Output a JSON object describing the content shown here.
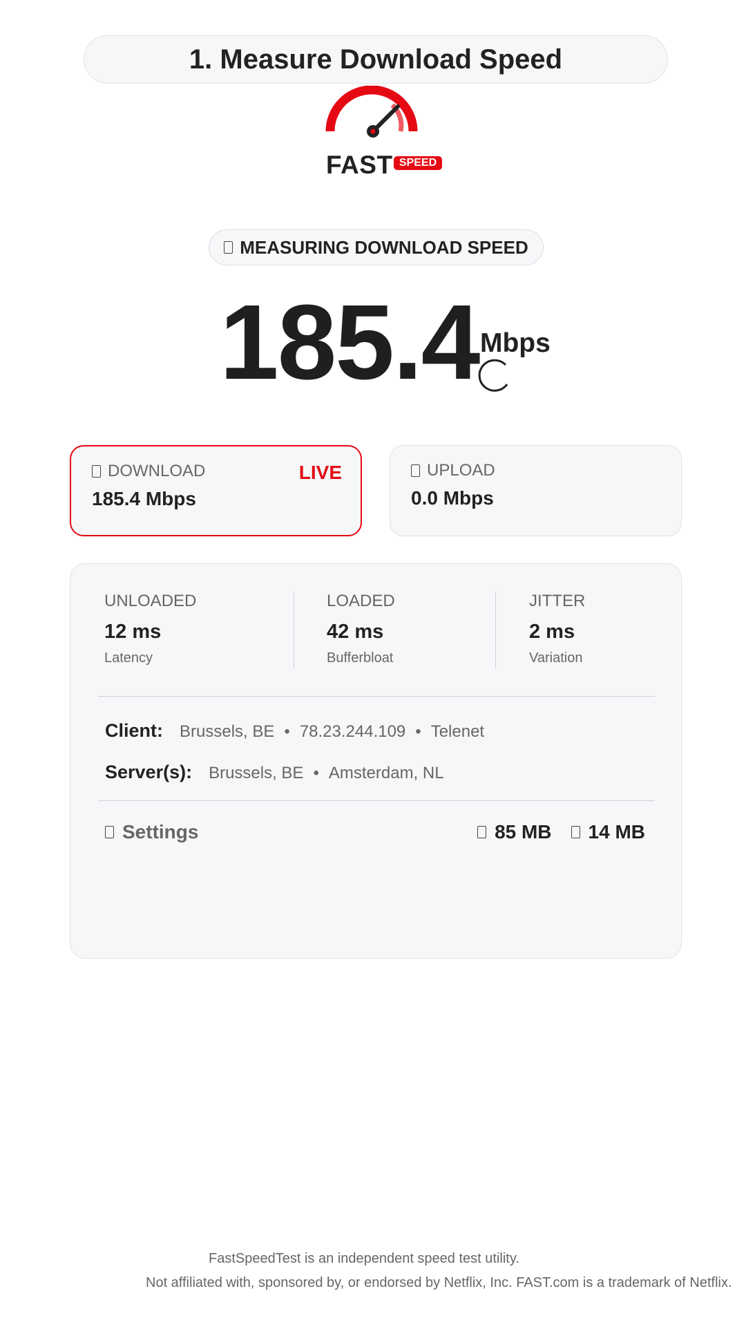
{
  "header": {
    "title": "1. Measure Download Speed"
  },
  "logo": {
    "word": "FAST",
    "badge": "SPEED",
    "brand_color": "#e50914",
    "icon": "speedometer-icon"
  },
  "status": {
    "icon": "gauge-icon",
    "text": "MEASURING DOWNLOAD SPEED"
  },
  "measurement": {
    "value": "185.4",
    "unit": "Mbps",
    "loading_icon": "spinner-icon"
  },
  "cards": {
    "download": {
      "icon": "download-icon",
      "label": "DOWNLOAD",
      "value": "185.4 Mbps",
      "badge": "LIVE"
    },
    "upload": {
      "icon": "upload-icon",
      "label": "UPLOAD",
      "value": "0.0 Mbps"
    }
  },
  "metrics": [
    {
      "label": "UNLOADED",
      "value": "12 ms",
      "sub": "Latency"
    },
    {
      "label": "LOADED",
      "value": "42 ms",
      "sub": "Bufferbloat"
    },
    {
      "label": "JITTER",
      "value": "2 ms",
      "sub": "Variation"
    }
  ],
  "client": {
    "label": "Client:",
    "location": "Brussels, BE",
    "ip": "78.23.244.109",
    "isp": "Telenet"
  },
  "servers": {
    "label": "Server(s):",
    "items": [
      "Brussels, BE",
      "Amsterdam, NL"
    ]
  },
  "settings": {
    "icon": "gear-icon",
    "label": "Settings"
  },
  "data_usage": {
    "download": {
      "icon": "download-data-icon",
      "value": "85 MB"
    },
    "upload": {
      "icon": "upload-data-icon",
      "value": "14 MB"
    }
  },
  "footer": {
    "line1": "FastSpeedTest is an independent speed test utility.",
    "line2": "Not affiliated with, sponsored by, or endorsed by Netflix, Inc. FAST.com is a trademark of Netflix."
  },
  "colors": {
    "accent": "#e50914",
    "panel": "#f6f7f9",
    "text": "#222222",
    "muted": "#666666"
  }
}
